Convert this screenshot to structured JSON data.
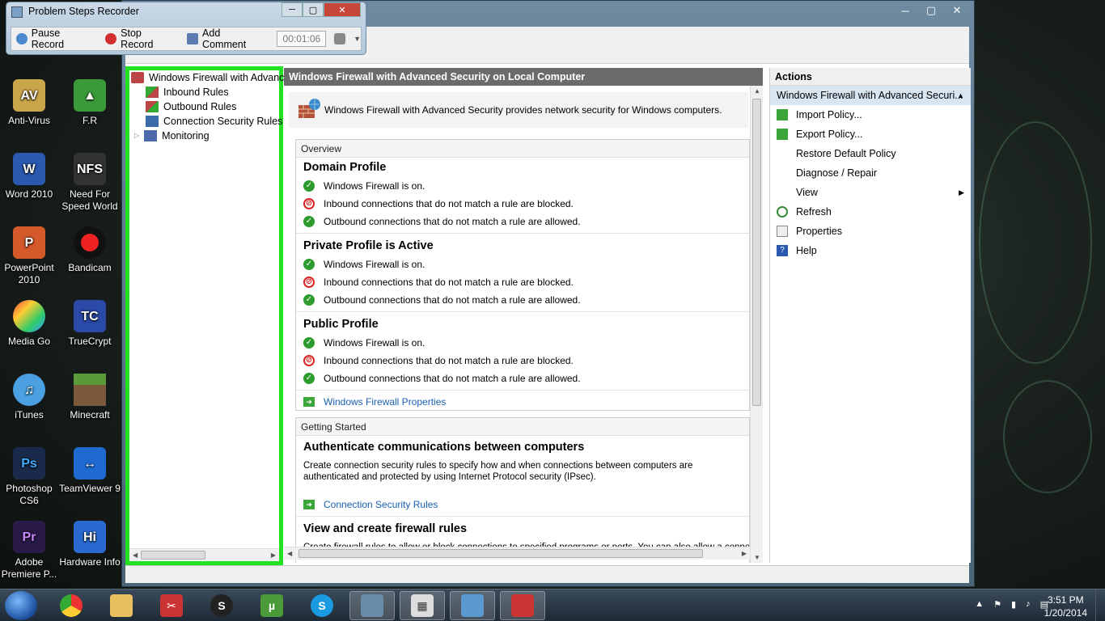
{
  "psr": {
    "title": "Problem Steps Recorder",
    "pause_label": "Pause Record",
    "stop_label": "Stop Record",
    "add_comment_label": "Add Comment",
    "timer": "00:01:06"
  },
  "desktop_icons": [
    "Anti-Virus",
    "F.R",
    "Word 2010",
    "Need For Speed World",
    "PowerPoint 2010",
    "Bandicam",
    "Media Go",
    "TrueCrypt",
    "iTunes",
    "Minecraft",
    "Photoshop CS6",
    "TeamViewer 9",
    "Adobe Premiere P...",
    "Hardware Info"
  ],
  "tree": {
    "root": "Windows Firewall with Advanc",
    "items": [
      "Inbound Rules",
      "Outbound Rules",
      "Connection Security Rules",
      "Monitoring"
    ]
  },
  "center": {
    "header": "Windows Firewall with Advanced Security on Local Computer",
    "intro": "Windows Firewall with Advanced Security provides network security for Windows computers.",
    "overview_title": "Overview",
    "profiles": [
      {
        "name": "Domain Profile",
        "lines": [
          "Windows Firewall is on.",
          "Inbound connections that do not match a rule are blocked.",
          "Outbound connections that do not match a rule are allowed."
        ]
      },
      {
        "name": "Private Profile is Active",
        "lines": [
          "Windows Firewall is on.",
          "Inbound connections that do not match a rule are blocked.",
          "Outbound connections that do not match a rule are allowed."
        ]
      },
      {
        "name": "Public Profile",
        "lines": [
          "Windows Firewall is on.",
          "Inbound connections that do not match a rule are blocked.",
          "Outbound connections that do not match a rule are allowed."
        ]
      }
    ],
    "properties_link": "Windows Firewall Properties",
    "getting_started_title": "Getting Started",
    "auth_title": "Authenticate communications between computers",
    "auth_text": "Create connection security rules to specify how and when connections between computers are authenticated and protected by using Internet Protocol security (IPsec).",
    "conn_link": "Connection Security Rules",
    "rules_title": "View and create firewall rules",
    "rules_text": "Create firewall rules to allow or block connections to specified programs or ports. You can also allow a connection only"
  },
  "actions": {
    "header": "Actions",
    "group": "Windows Firewall with Advanced Securi...",
    "items": [
      "Import Policy...",
      "Export Policy...",
      "Restore Default Policy",
      "Diagnose / Repair",
      "View",
      "Refresh",
      "Properties",
      "Help"
    ]
  },
  "clock": {
    "time": "3:51 PM",
    "date": "1/20/2014"
  },
  "colors": {
    "highlight_border": "#22e022",
    "header_bg": "#6b6b6b",
    "link": "#1a5fb4"
  }
}
